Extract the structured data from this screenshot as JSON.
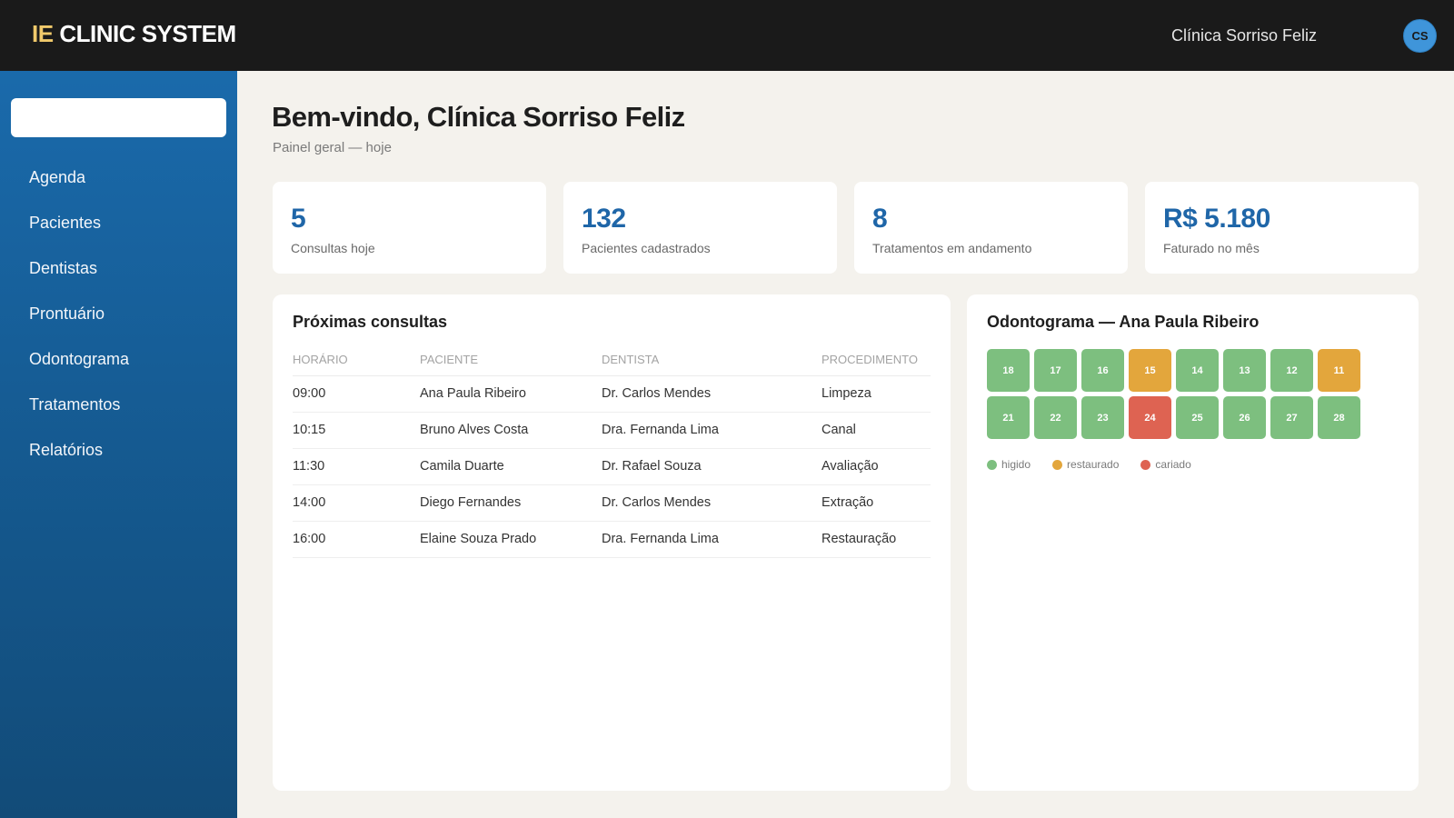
{
  "header": {
    "brand_prefix": "IE",
    "brand_name": "CLINIC SYSTEM",
    "clinic_name": "Clínica Sorriso Feliz",
    "avatar_initials": "CS"
  },
  "sidebar": {
    "search_value": "",
    "items": [
      {
        "label": "Agenda"
      },
      {
        "label": "Pacientes"
      },
      {
        "label": "Dentistas"
      },
      {
        "label": "Prontuário"
      },
      {
        "label": "Odontograma"
      },
      {
        "label": "Tratamentos"
      },
      {
        "label": "Relatórios"
      }
    ]
  },
  "page": {
    "title": "Bem-vindo, Clínica Sorriso Feliz",
    "subtitle": "Painel geral — hoje"
  },
  "stats": [
    {
      "value": "5",
      "label": "Consultas hoje"
    },
    {
      "value": "132",
      "label": "Pacientes cadastrados"
    },
    {
      "value": "8",
      "label": "Tratamentos em andamento"
    },
    {
      "value": "R$ 5.180",
      "label": "Faturado no mês"
    }
  ],
  "appointments": {
    "title": "Próximas consultas",
    "columns": [
      "Horário",
      "Paciente",
      "Dentista",
      "Procedimento"
    ],
    "rows": [
      [
        "09:00",
        "Ana Paula Ribeiro",
        "Dr. Carlos Mendes",
        "Limpeza"
      ],
      [
        "10:15",
        "Bruno Alves Costa",
        "Dra. Fernanda Lima",
        "Canal"
      ],
      [
        "11:30",
        "Camila Duarte",
        "Dr. Rafael Souza",
        "Avaliação"
      ],
      [
        "14:00",
        "Diego Fernandes",
        "Dr. Carlos Mendes",
        "Extração"
      ],
      [
        "16:00",
        "Elaine Souza Prado",
        "Dra. Fernanda Lima",
        "Restauração"
      ]
    ]
  },
  "odontogram": {
    "title": "Odontograma — Ana Paula Ribeiro",
    "rows": [
      [
        {
          "number": "18",
          "status": "higido"
        },
        {
          "number": "17",
          "status": "higido"
        },
        {
          "number": "16",
          "status": "higido"
        },
        {
          "number": "15",
          "status": "restaurado"
        },
        {
          "number": "14",
          "status": "higido"
        },
        {
          "number": "13",
          "status": "higido"
        },
        {
          "number": "12",
          "status": "higido"
        },
        {
          "number": "11",
          "status": "restaurado"
        }
      ],
      [
        {
          "number": "21",
          "status": "higido"
        },
        {
          "number": "22",
          "status": "higido"
        },
        {
          "number": "23",
          "status": "higido"
        },
        {
          "number": "24",
          "status": "cariado"
        },
        {
          "number": "25",
          "status": "higido"
        },
        {
          "number": "26",
          "status": "higido"
        },
        {
          "number": "27",
          "status": "higido"
        },
        {
          "number": "28",
          "status": "higido"
        }
      ]
    ],
    "legend": [
      {
        "key": "higido",
        "label": "higido"
      },
      {
        "key": "restaurado",
        "label": "restaurado"
      },
      {
        "key": "cariado",
        "label": "cariado"
      }
    ],
    "colors": {
      "higido": "#7dbf7f",
      "restaurado": "#e3a63c",
      "cariado": "#de6352"
    }
  }
}
